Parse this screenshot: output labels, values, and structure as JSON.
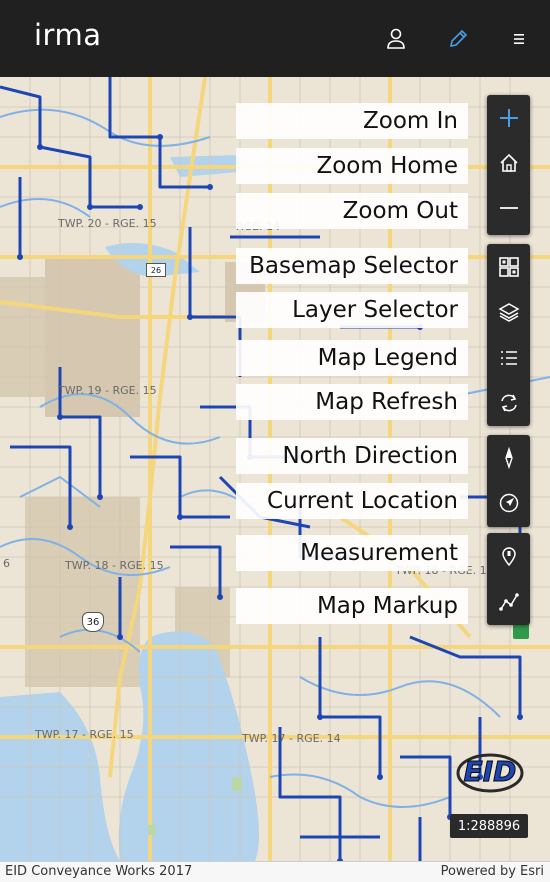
{
  "app": {
    "title": "irma"
  },
  "header": {
    "user_icon": "user-icon",
    "edit_icon": "pencil-icon",
    "menu_icon": "menu-icon",
    "accent": "#4a9ee8"
  },
  "map": {
    "labels": {
      "twp20": "TWP. 20 - RGE. 15",
      "twp19": "TWP. 19 - RGE. 15",
      "twp18a": "TWP. 18 - RGE. 15",
      "twp18b": "TWP. 18 - RGE. 14",
      "twp17a": "TWP. 17 - RGE. 15",
      "twp17b": "TWP. 17 - RGE. 14",
      "twp20r": "RGE. 14",
      "edge6": "6",
      "hwy36": "36",
      "hwy26": "26"
    },
    "logo_text": "EID",
    "scale": "1:288896"
  },
  "tooltips": [
    "Zoom In",
    "Zoom Home",
    "Zoom Out",
    "Basemap Selector",
    "Layer Selector",
    "Map Legend",
    "Map Refresh",
    "North Direction",
    "Current Location",
    "Measurement",
    "Map Markup"
  ],
  "tools": [
    "plus-icon",
    "home-icon",
    "minus-icon",
    "basemap-grid-icon",
    "layers-icon",
    "list-icon",
    "refresh-icon",
    "compass-icon",
    "locate-icon",
    "measure-pin-icon",
    "polyline-icon"
  ],
  "footer": {
    "attribution": "EID Conveyance Works 2017",
    "powered_by": "Powered by Esri"
  }
}
